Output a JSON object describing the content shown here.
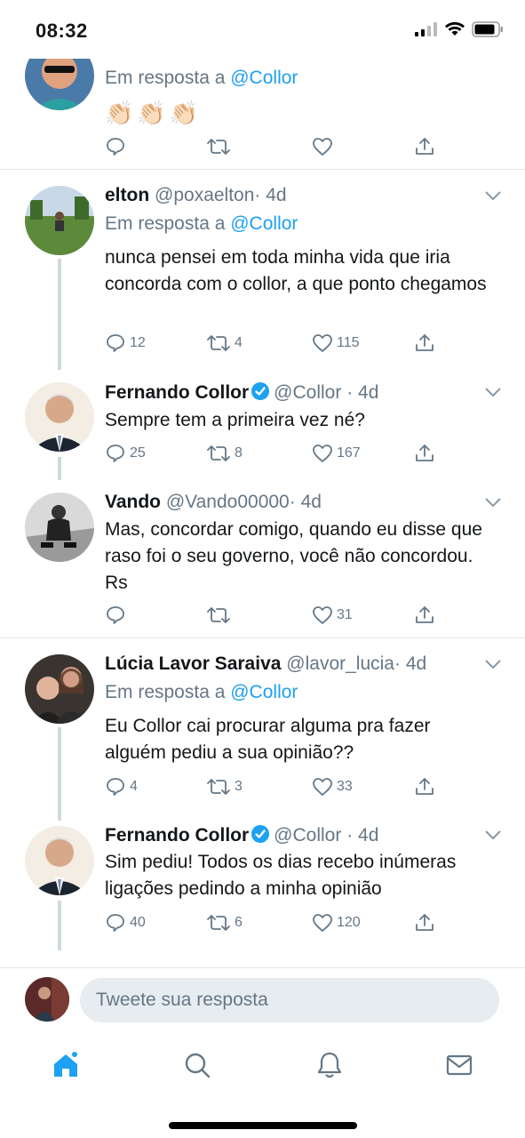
{
  "status": {
    "time": "08:32"
  },
  "tweets": [
    {
      "reply_prefix": "Em resposta a ",
      "reply_mention": "@Collor",
      "avatar_icon": "person-sunglasses-avatar",
      "emoji": [
        "👏🏻",
        "👏🏻",
        "👏🏻"
      ],
      "counts": {
        "reply": "",
        "retweet": "",
        "like": ""
      }
    },
    {
      "name": "elton",
      "handle": "@poxaelton",
      "time": "· 4d",
      "reply_prefix": "Em resposta a ",
      "reply_mention": "@Collor",
      "text": "nunca pensei em toda minha vida que iria concorda com o collor, a que ponto chegamos",
      "counts": {
        "reply": "12",
        "retweet": "4",
        "like": "115"
      }
    },
    {
      "name": "Fernando Collor",
      "handle": "@Collor",
      "time": "· 4d",
      "verified": true,
      "text": "Sempre tem a primeira vez né?",
      "counts": {
        "reply": "25",
        "retweet": "8",
        "like": "167"
      }
    },
    {
      "name": "Vando",
      "handle": "@Vando00000",
      "time": "· 4d",
      "text": "Mas, concordar comigo, quando eu disse que raso foi o seu governo, você não concordou. Rs",
      "counts": {
        "reply": "",
        "retweet": "",
        "like": "31"
      }
    },
    {
      "name": "Lúcia Lavor Saraiva",
      "handle": "@lavor_lucia",
      "time": "· 4d",
      "reply_prefix": "Em resposta a ",
      "reply_mention": "@Collor",
      "text": "Eu Collor cai procurar  alguma  pra fazer alguém  pediu  a sua opinião??",
      "counts": {
        "reply": "4",
        "retweet": "3",
        "like": "33"
      }
    },
    {
      "name": "Fernando Collor",
      "handle": "@Collor",
      "time": "· 4d",
      "verified": true,
      "text": "Sim pediu! Todos os dias recebo inúmeras ligações pedindo a minha opinião",
      "counts": {
        "reply": "40",
        "retweet": "6",
        "like": "120"
      }
    }
  ],
  "compose": {
    "placeholder": "Tweete sua resposta"
  },
  "colors": {
    "accent": "#1da1f2",
    "secondary_text": "#657786",
    "divider": "#e1e8ed"
  },
  "tabs": [
    "home-icon",
    "search-icon",
    "notifications-icon",
    "messages-icon"
  ]
}
